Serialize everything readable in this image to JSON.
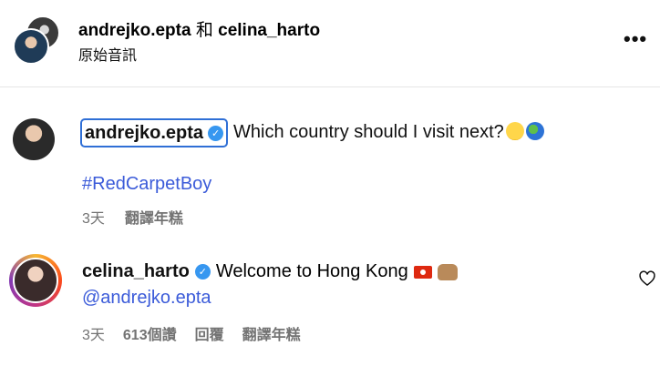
{
  "header": {
    "user1": "andrejko.epta",
    "connector": "和",
    "user2": "celina_harto",
    "subtitle": "原始音訊",
    "more_label": "•••"
  },
  "post": {
    "username": "andrejko.epta",
    "verified": true,
    "caption": "Which country should I visit next?",
    "caption_emojis": [
      "zany-face-emoji",
      "globe-emoji"
    ],
    "hashtag": "#RedCarpetBoy",
    "time": "3天",
    "translate": "翻譯年糕"
  },
  "comment": {
    "username": "celina_harto",
    "verified": true,
    "text": "Welcome to Hong Kong",
    "emojis": [
      "hong-kong-flag-emoji",
      "raising-hands-emoji"
    ],
    "mention": "@andrejko.epta",
    "time": "3天",
    "likes": "613個讚",
    "reply": "回覆",
    "translate": "翻譯年糕"
  },
  "colors": {
    "link": "#3b5bd9",
    "verified": "#3797f0",
    "focus": "#2f6fd6",
    "meta": "#737373"
  }
}
